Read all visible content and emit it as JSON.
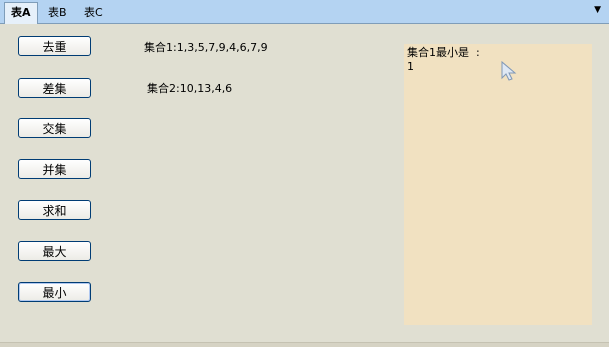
{
  "tabs": [
    {
      "label": "表A",
      "active": true
    },
    {
      "label": "表B",
      "active": false
    },
    {
      "label": "表C",
      "active": false
    }
  ],
  "tab_menu_icon": "dropdown-arrow-icon",
  "buttons": {
    "dedupe": "去重",
    "difference": "差集",
    "intersection": "交集",
    "union": "并集",
    "sum": "求和",
    "max": "最大",
    "min": "最小"
  },
  "sets": {
    "set1": "集合1:1,3,5,7,9,4,6,7,9",
    "set2": "集合2:10,13,4,6"
  },
  "result": {
    "line1": "集合1最小是  :",
    "line2": "1"
  },
  "colors": {
    "tabbar": "#b4d3f2",
    "panel": "#e0dfd2",
    "result_box": "#f1e1c1",
    "button_border": "#003c74"
  }
}
